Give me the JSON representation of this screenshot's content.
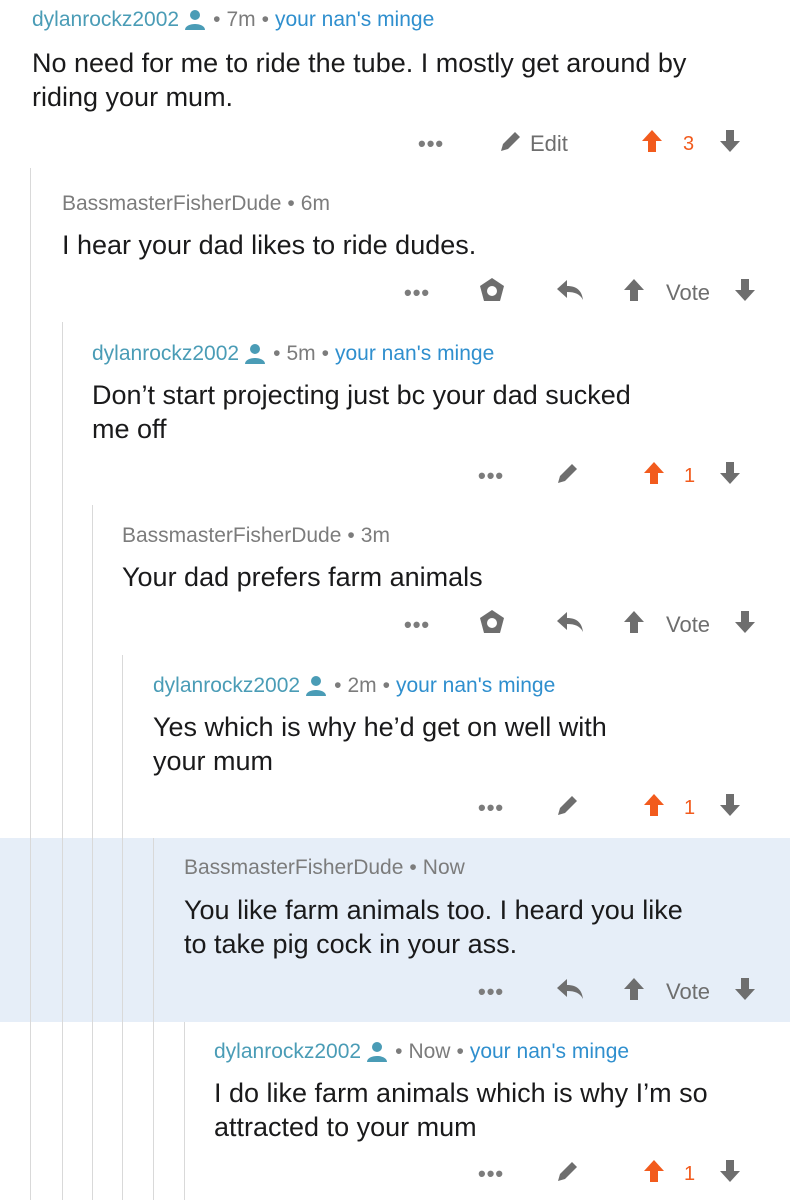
{
  "colors": {
    "op_user": "#4a9cb6",
    "flair": "#2f8fce",
    "upvoted": "#f25b1d",
    "highlight_bg": "#e6eef8"
  },
  "comments": [
    {
      "user": "dylanrockz2002",
      "time": "7m",
      "flair": "your nan's minge",
      "lines": [
        "No need for me to ride the tube. I mostly get around by",
        "riding your mum."
      ],
      "more": "•••",
      "edit": "Edit",
      "score": "3"
    },
    {
      "user": "BassmasterFisherDude",
      "time": "6m",
      "lines": [
        "I hear your dad likes to ride dudes."
      ],
      "more": "•••",
      "vote": "Vote"
    },
    {
      "user": "dylanrockz2002",
      "time": "5m",
      "flair": "your nan's minge",
      "lines": [
        "Don’t start projecting just bc your dad sucked",
        "me off"
      ],
      "more": "•••",
      "score": "1"
    },
    {
      "user": "BassmasterFisherDude",
      "time": "3m",
      "lines": [
        "Your dad prefers farm animals"
      ],
      "more": "•••",
      "vote": "Vote"
    },
    {
      "user": "dylanrockz2002",
      "time": "2m",
      "flair": "your nan's minge",
      "lines": [
        "Yes which is why he’d get on well with",
        "your mum"
      ],
      "more": "•••",
      "score": "1"
    },
    {
      "user": "BassmasterFisherDude",
      "time": "Now",
      "lines": [
        "You like farm animals too. I heard you like",
        "to take pig cock in your ass."
      ],
      "more": "•••",
      "vote": "Vote"
    },
    {
      "user": "dylanrockz2002",
      "time": "Now",
      "flair": "your nan's minge",
      "lines": [
        "I do like farm animals which is why I’m so",
        "attracted to your mum"
      ],
      "more": "•••",
      "score": "1"
    }
  ]
}
